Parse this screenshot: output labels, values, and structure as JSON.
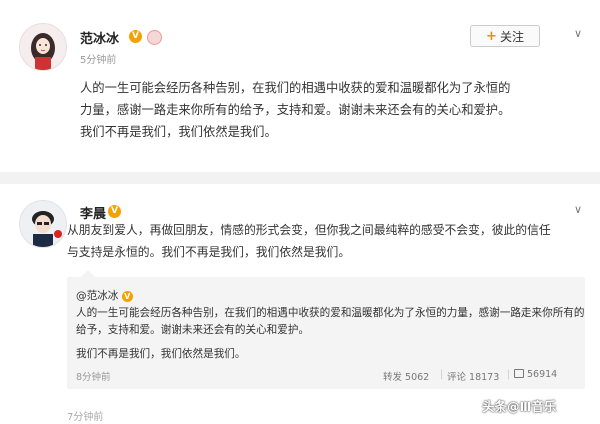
{
  "post1": {
    "author": "范冰冰",
    "verified_badge": "V",
    "time": "5分钟前",
    "follow_label": "关注",
    "text_lines": [
      "人的一生可能会经历各种告别，在我们的相遇中收获的爱和温暖都化为了永恒的",
      "力量，感谢一路走来你所有的给予，支持和爱。谢谢未来还会有的关心和爱护。",
      "我们不再是我们，我们依然是我们。"
    ]
  },
  "post2": {
    "author": "李晨",
    "verified_badge": "V",
    "text_lines": [
      "从朋友到爱人，再做回朋友，情感的形式会变，但你我之间最纯粹的感受不会变，彼此的信任",
      "与支持是永恒的。我们不再是我们，我们依然是我们。"
    ],
    "quoted": {
      "author": "@范冰冰",
      "verified_badge": "V",
      "text_lines": [
        "人的一生可能会经历各种告别，在我们的相遇中收获的爱和温暖都化为了永恒的力量，感谢一路走来你所有的",
        "给予，支持和爱。谢谢未来还会有的关心和爱护。",
        "我们不再是我们，我们依然是我们。"
      ],
      "time": "8分钟前",
      "repost": "转发 5062",
      "comment": "评论 18173",
      "like": "56914"
    },
    "time_partial": "7分钟前"
  },
  "watermark": "头条@Ⅲ音乐"
}
